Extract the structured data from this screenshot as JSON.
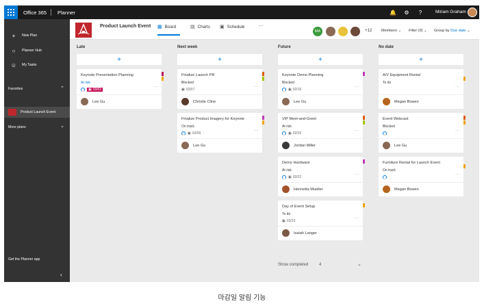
{
  "topbar": {
    "brand": "Office 365",
    "app": "Planner",
    "user_name": "Miriam Graham",
    "icons": [
      "waffle-icon",
      "bell-icon",
      "gear-icon",
      "help-icon"
    ]
  },
  "nav": {
    "new_plan": "New Plan",
    "planner_hub": "Planner Hub",
    "my_tasks": "My Tasks",
    "favorites": "Favorites",
    "favorite_plan": "Product Launch Event",
    "more_plans": "More plans",
    "get_app": "Get the Planner app",
    "collapse_icon": "chevron-left-icon"
  },
  "plan": {
    "title": "Product Launch Event",
    "tabs": {
      "board": "Board",
      "charts": "Charts",
      "schedule": "Schedule"
    },
    "more": "···",
    "member_initials": "MA",
    "members_extra": "+12",
    "members_label": "Members",
    "filter_label": "Filter (0)",
    "group_label": "Group by",
    "group_value": "Due date",
    "colors": {
      "accent": "#0078d4",
      "late": "#c50f55",
      "nav_bg": "#333333",
      "plan_logo": "#c0262d"
    }
  },
  "buckets": [
    {
      "title": "Late",
      "cards": [
        {
          "title": "Keynote Presentation Planning",
          "status": "At risk",
          "date": "03/01",
          "late": true,
          "assignee": "Lee Gu"
        }
      ]
    },
    {
      "title": "Next week",
      "cards": [
        {
          "title": "Finalize Launch PR",
          "status": "Blocked",
          "date": "02/07",
          "assignee": "Christie Cline"
        },
        {
          "title": "Finalize Product Imagery for Keynote",
          "status": "On track",
          "date": "02/09",
          "assignee": "Lee Gu"
        }
      ]
    },
    {
      "title": "Future",
      "cards": [
        {
          "title": "Keynote Demo Planning",
          "status": "Blocked",
          "date": "02/16",
          "assignee": "Lee Gu"
        },
        {
          "title": "VIP Meet-and-Greet",
          "status": "At risk",
          "date": "02/20",
          "assignee": "Jordan Miller"
        },
        {
          "title": "Demo Hardware",
          "status": "At risk",
          "date": "02/22",
          "assignee": "Henrietta Mueller"
        },
        {
          "title": "Day of Event Setup",
          "status": "To do",
          "date": "02/23",
          "assignee": "Isaiah Langer"
        }
      ],
      "show_completed": "Show completed",
      "completed_count": "4"
    },
    {
      "title": "No date",
      "cards": [
        {
          "title": "A/V Equipment Rental",
          "status": "To do",
          "assignee": "Megan Bowen"
        },
        {
          "title": "Event Webcast",
          "status": "Blocked",
          "assignee": "Lee Gu"
        },
        {
          "title": "Furniture Rental for Launch Event",
          "status": "On track",
          "assignee": "Megan Bowen"
        }
      ]
    }
  ],
  "caption": "마감일 알림 기능"
}
